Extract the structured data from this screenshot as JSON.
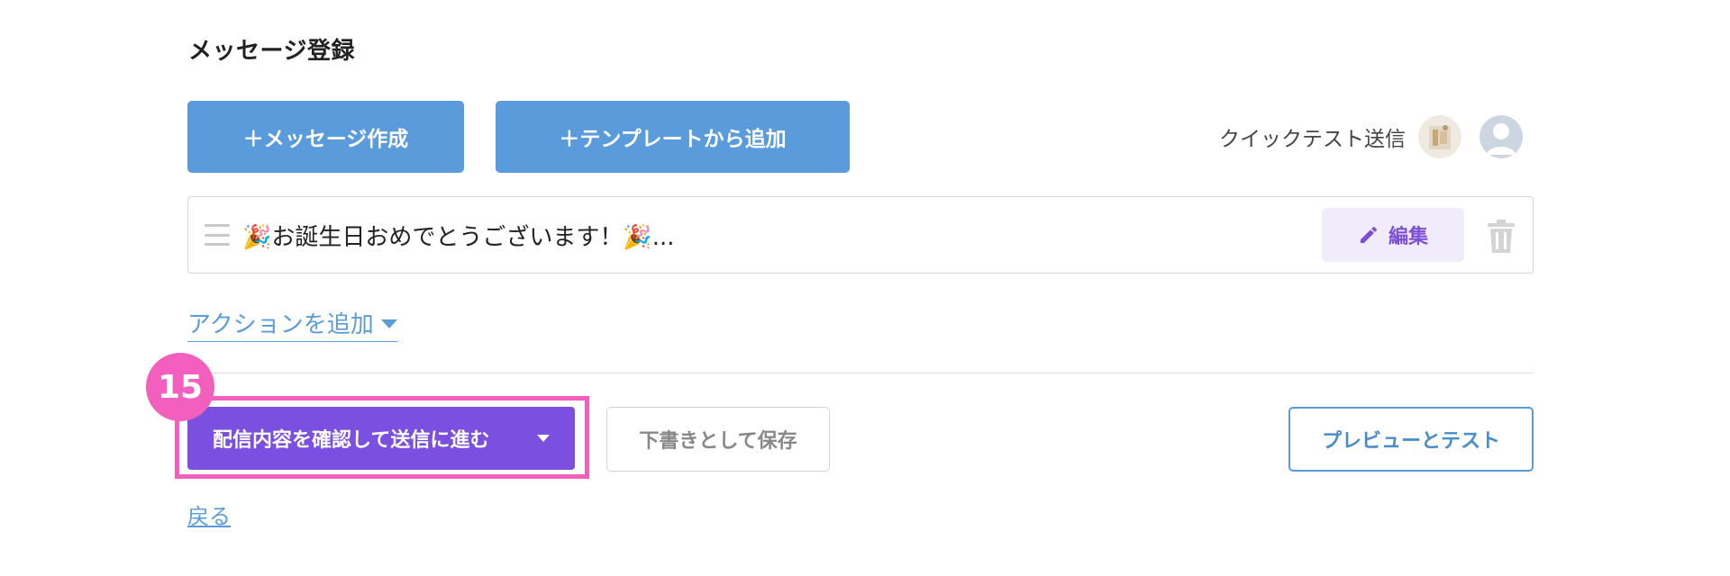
{
  "page": {
    "title": "メッセージ登録"
  },
  "toolbar": {
    "create_label": "＋メッセージ作成",
    "template_label": "＋テンプレートから追加"
  },
  "quick_test": {
    "label": "クイックテスト送信",
    "avatars": [
      "photo-avatar",
      "default-avatar"
    ]
  },
  "message": {
    "text": "🎉お誕生日おめでとうございます！🎉...",
    "edit_label": "編集",
    "icons": {
      "drag": "drag-handle-icon",
      "edit": "pencil-icon",
      "delete": "trash-icon"
    }
  },
  "action": {
    "add_label": "アクションを追加"
  },
  "annotation": {
    "step_number": "15",
    "highlight_color": "#f25fbd"
  },
  "footer": {
    "confirm_label": "配信内容を確認して送信に進む",
    "draft_label": "下書きとして保存",
    "preview_label": "プレビューとテスト",
    "back_label": "戻る"
  },
  "colors": {
    "primary_blue": "#5a9bdc",
    "primary_purple": "#7b4fe0",
    "edit_bg": "#f1ecfb",
    "badge_pink": "#f25fbd"
  }
}
